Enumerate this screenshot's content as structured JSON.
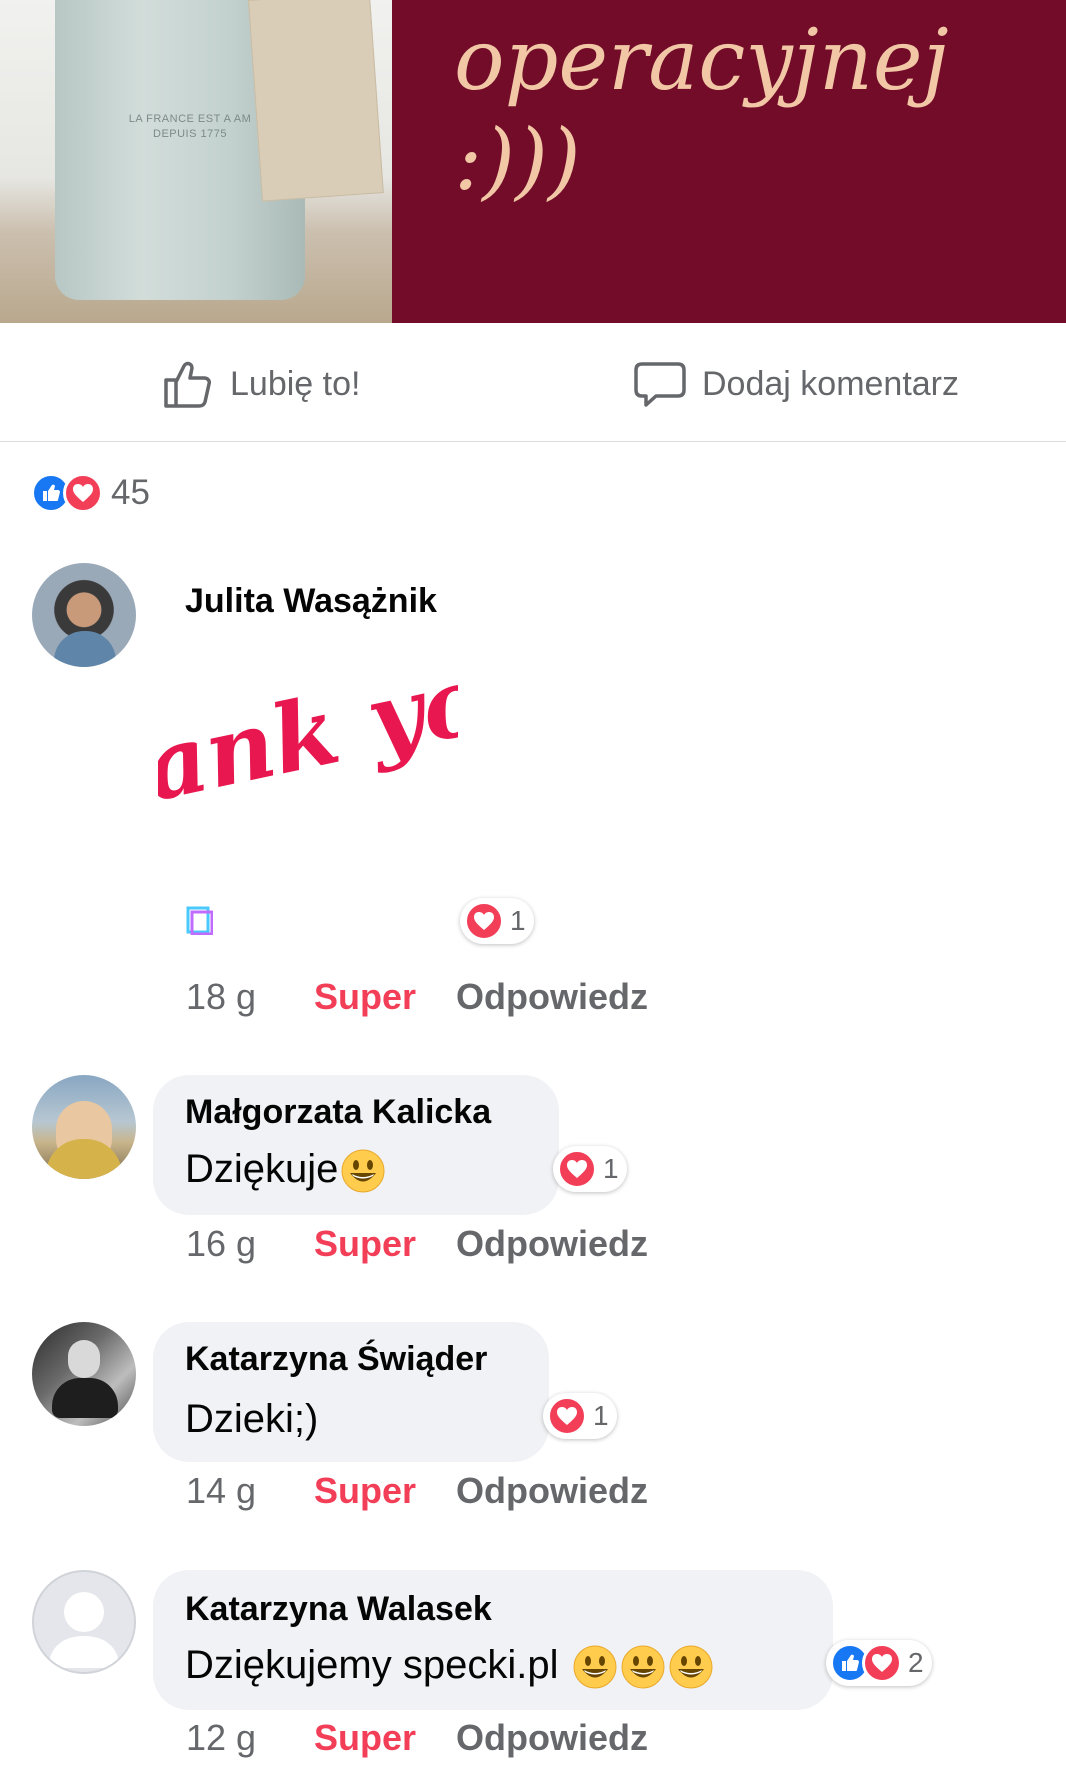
{
  "banner": {
    "text_line1": "operacyjnej",
    "text_line2": ":)))",
    "jug_engraving": "LA FRANCE EST A AM\nDEPUIS 1775",
    "bg_color": "#720c29",
    "text_color": "#f1c7a6"
  },
  "actions": {
    "like_label": "Lubię to!",
    "comment_label": "Dodaj komentarz",
    "like_icon": "thumbs-up-outline-icon",
    "comment_icon": "speech-bubble-icon"
  },
  "post_reactions": {
    "count": "45",
    "types": [
      "like",
      "love"
    ]
  },
  "comments": [
    {
      "author": "Julita Wasążnik",
      "sticker": "Thank you!",
      "time": "18 g",
      "super_label": "Super",
      "reply_label": "Odpowiedz",
      "reaction_count": "1",
      "reaction_types": [
        "love"
      ]
    },
    {
      "author": "Małgorzata Kalicka",
      "text": "Dziękuje",
      "emojis": [
        "grinning-face-emoji"
      ],
      "time": "16 g",
      "super_label": "Super",
      "reply_label": "Odpowiedz",
      "reaction_count": "1",
      "reaction_types": [
        "love"
      ]
    },
    {
      "author": "Katarzyna Świąder",
      "text": "Dzieki;)",
      "time": "14 g",
      "super_label": "Super",
      "reply_label": "Odpowiedz",
      "reaction_count": "1",
      "reaction_types": [
        "love"
      ]
    },
    {
      "author": "Katarzyna Walasek",
      "text": "Dziękujemy specki.pl",
      "emojis": [
        "grinning-face-emoji",
        "grinning-face-emoji",
        "grinning-face-emoji"
      ],
      "time": "12 g",
      "super_label": "Super",
      "reply_label": "Odpowiedz",
      "reaction_count": "2",
      "reaction_types": [
        "like",
        "love"
      ]
    }
  ],
  "colors": {
    "like_blue": "#1877f2",
    "love_red": "#f33e58",
    "bubble_gray": "#f0f2f5",
    "secondary_text": "#65676b"
  }
}
